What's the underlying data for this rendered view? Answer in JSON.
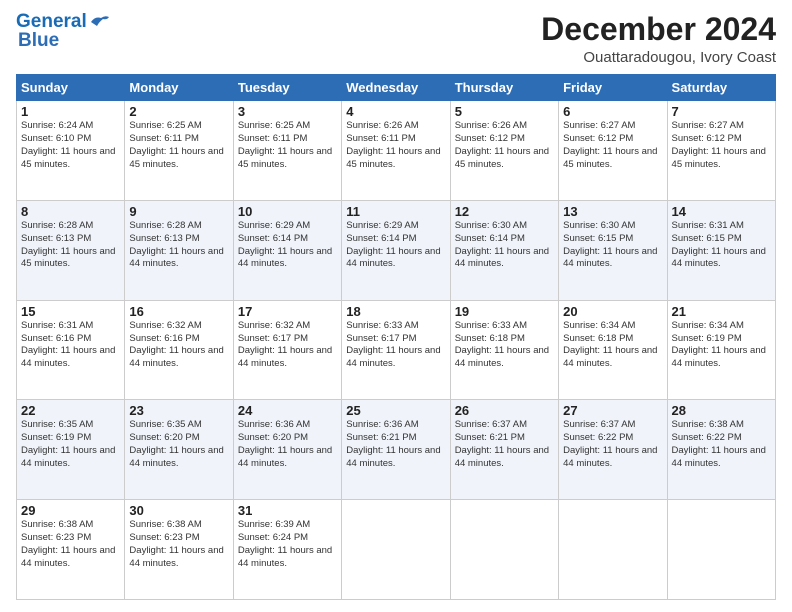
{
  "header": {
    "logo_line1": "General",
    "logo_line2": "Blue",
    "month_title": "December 2024",
    "location": "Ouattaradougou, Ivory Coast"
  },
  "weekdays": [
    "Sunday",
    "Monday",
    "Tuesday",
    "Wednesday",
    "Thursday",
    "Friday",
    "Saturday"
  ],
  "weeks": [
    [
      {
        "day": 1,
        "rise": "6:24 AM",
        "set": "6:10 PM",
        "daylight": "11 hours and 45 minutes."
      },
      {
        "day": 2,
        "rise": "6:25 AM",
        "set": "6:11 PM",
        "daylight": "11 hours and 45 minutes."
      },
      {
        "day": 3,
        "rise": "6:25 AM",
        "set": "6:11 PM",
        "daylight": "11 hours and 45 minutes."
      },
      {
        "day": 4,
        "rise": "6:26 AM",
        "set": "6:11 PM",
        "daylight": "11 hours and 45 minutes."
      },
      {
        "day": 5,
        "rise": "6:26 AM",
        "set": "6:12 PM",
        "daylight": "11 hours and 45 minutes."
      },
      {
        "day": 6,
        "rise": "6:27 AM",
        "set": "6:12 PM",
        "daylight": "11 hours and 45 minutes."
      },
      {
        "day": 7,
        "rise": "6:27 AM",
        "set": "6:12 PM",
        "daylight": "11 hours and 45 minutes."
      }
    ],
    [
      {
        "day": 8,
        "rise": "6:28 AM",
        "set": "6:13 PM",
        "daylight": "11 hours and 45 minutes."
      },
      {
        "day": 9,
        "rise": "6:28 AM",
        "set": "6:13 PM",
        "daylight": "11 hours and 44 minutes."
      },
      {
        "day": 10,
        "rise": "6:29 AM",
        "set": "6:14 PM",
        "daylight": "11 hours and 44 minutes."
      },
      {
        "day": 11,
        "rise": "6:29 AM",
        "set": "6:14 PM",
        "daylight": "11 hours and 44 minutes."
      },
      {
        "day": 12,
        "rise": "6:30 AM",
        "set": "6:14 PM",
        "daylight": "11 hours and 44 minutes."
      },
      {
        "day": 13,
        "rise": "6:30 AM",
        "set": "6:15 PM",
        "daylight": "11 hours and 44 minutes."
      },
      {
        "day": 14,
        "rise": "6:31 AM",
        "set": "6:15 PM",
        "daylight": "11 hours and 44 minutes."
      }
    ],
    [
      {
        "day": 15,
        "rise": "6:31 AM",
        "set": "6:16 PM",
        "daylight": "11 hours and 44 minutes."
      },
      {
        "day": 16,
        "rise": "6:32 AM",
        "set": "6:16 PM",
        "daylight": "11 hours and 44 minutes."
      },
      {
        "day": 17,
        "rise": "6:32 AM",
        "set": "6:17 PM",
        "daylight": "11 hours and 44 minutes."
      },
      {
        "day": 18,
        "rise": "6:33 AM",
        "set": "6:17 PM",
        "daylight": "11 hours and 44 minutes."
      },
      {
        "day": 19,
        "rise": "6:33 AM",
        "set": "6:18 PM",
        "daylight": "11 hours and 44 minutes."
      },
      {
        "day": 20,
        "rise": "6:34 AM",
        "set": "6:18 PM",
        "daylight": "11 hours and 44 minutes."
      },
      {
        "day": 21,
        "rise": "6:34 AM",
        "set": "6:19 PM",
        "daylight": "11 hours and 44 minutes."
      }
    ],
    [
      {
        "day": 22,
        "rise": "6:35 AM",
        "set": "6:19 PM",
        "daylight": "11 hours and 44 minutes."
      },
      {
        "day": 23,
        "rise": "6:35 AM",
        "set": "6:20 PM",
        "daylight": "11 hours and 44 minutes."
      },
      {
        "day": 24,
        "rise": "6:36 AM",
        "set": "6:20 PM",
        "daylight": "11 hours and 44 minutes."
      },
      {
        "day": 25,
        "rise": "6:36 AM",
        "set": "6:21 PM",
        "daylight": "11 hours and 44 minutes."
      },
      {
        "day": 26,
        "rise": "6:37 AM",
        "set": "6:21 PM",
        "daylight": "11 hours and 44 minutes."
      },
      {
        "day": 27,
        "rise": "6:37 AM",
        "set": "6:22 PM",
        "daylight": "11 hours and 44 minutes."
      },
      {
        "day": 28,
        "rise": "6:38 AM",
        "set": "6:22 PM",
        "daylight": "11 hours and 44 minutes."
      }
    ],
    [
      {
        "day": 29,
        "rise": "6:38 AM",
        "set": "6:23 PM",
        "daylight": "11 hours and 44 minutes."
      },
      {
        "day": 30,
        "rise": "6:38 AM",
        "set": "6:23 PM",
        "daylight": "11 hours and 44 minutes."
      },
      {
        "day": 31,
        "rise": "6:39 AM",
        "set": "6:24 PM",
        "daylight": "11 hours and 44 minutes."
      },
      null,
      null,
      null,
      null
    ]
  ]
}
